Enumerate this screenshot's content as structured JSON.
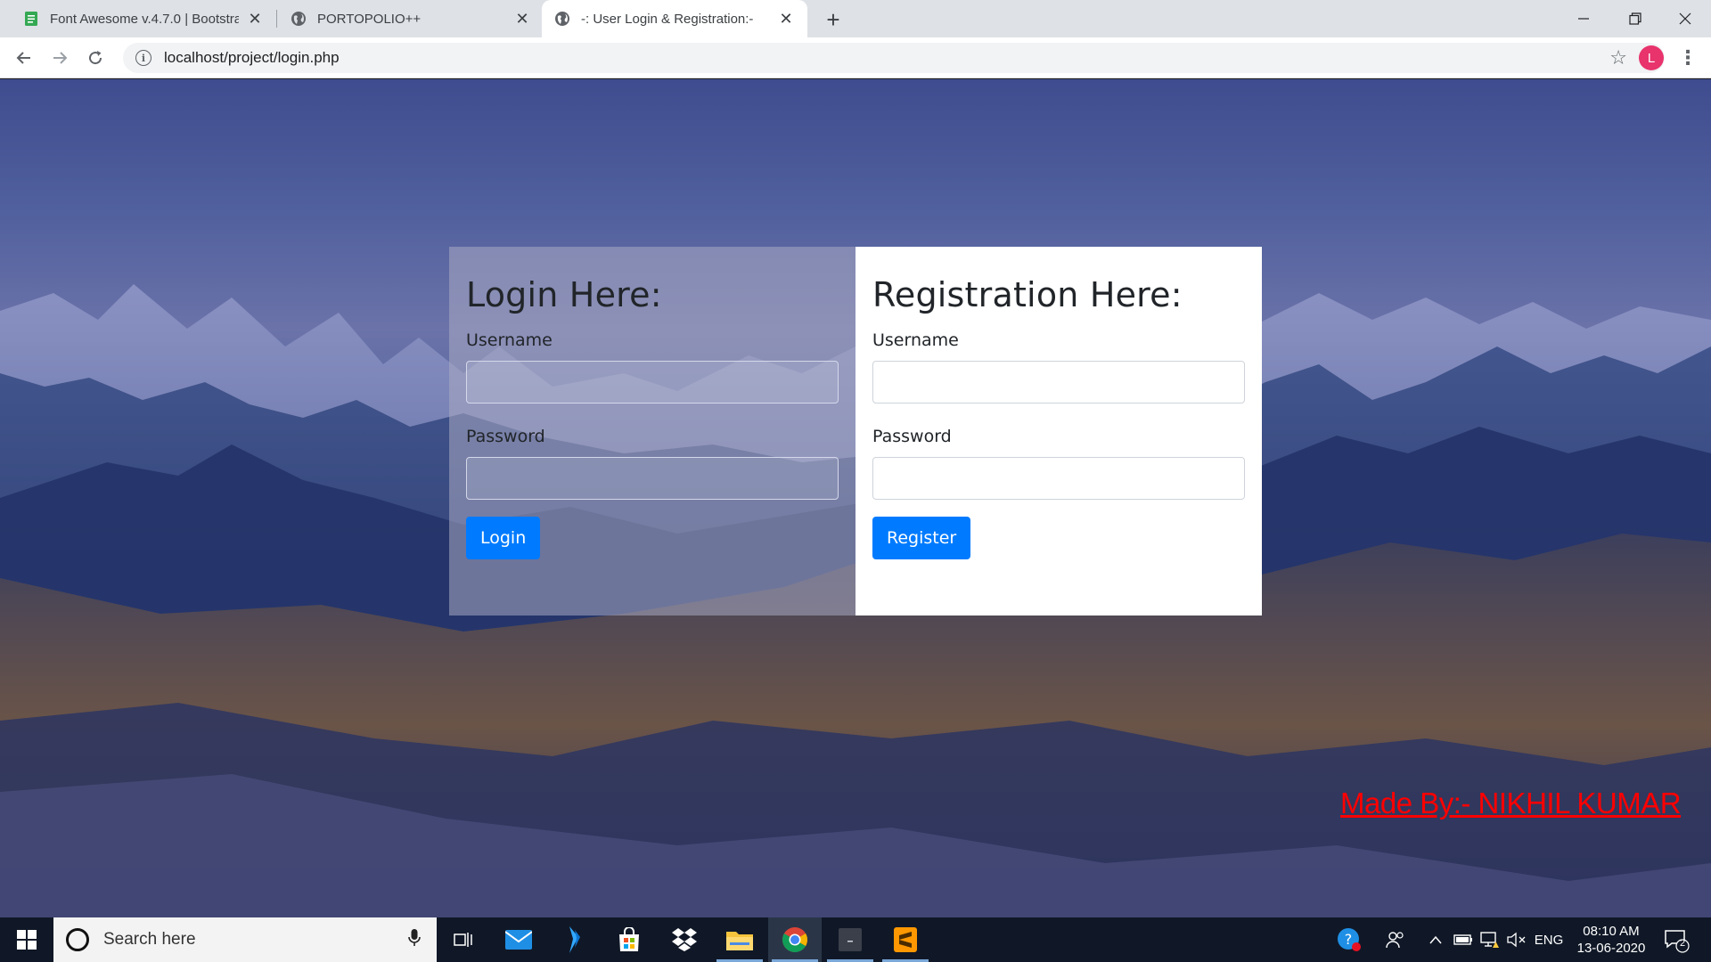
{
  "browser": {
    "tabs": [
      {
        "title": "Font Awesome v.4.7.0 | Bootstrap",
        "icon": "document-icon",
        "active": false
      },
      {
        "title": "PORTOPOLIO++",
        "icon": "globe-icon",
        "active": false
      },
      {
        "title": "-: User Login & Registration:-",
        "icon": "globe-icon",
        "active": true
      }
    ],
    "url": "localhost/project/login.php",
    "profile_initial": "L",
    "profile_color": "#e8336d"
  },
  "login": {
    "heading": "Login Here:",
    "username_label": "Username",
    "username_value": "",
    "password_label": "Password",
    "password_value": "",
    "button_label": "Login"
  },
  "register": {
    "heading": "Registration Here:",
    "username_label": "Username",
    "username_value": "",
    "password_label": "Password",
    "password_value": "",
    "button_label": "Register"
  },
  "credit": "Made By:- NIKHIL KUMAR",
  "colors": {
    "primary_button": "#007bff",
    "credit_text": "#ff0000"
  },
  "taskbar": {
    "search_placeholder": "Search here",
    "apps": [
      "task-view-icon",
      "mail-icon",
      "visual-studio-icon",
      "store-icon",
      "dropbox-icon",
      "file-explorer-icon",
      "chrome-icon",
      "terminal-icon",
      "sublime-text-icon"
    ],
    "language": "ENG",
    "time": "08:10 AM",
    "date": "13-06-2020",
    "notification_count": "2"
  }
}
